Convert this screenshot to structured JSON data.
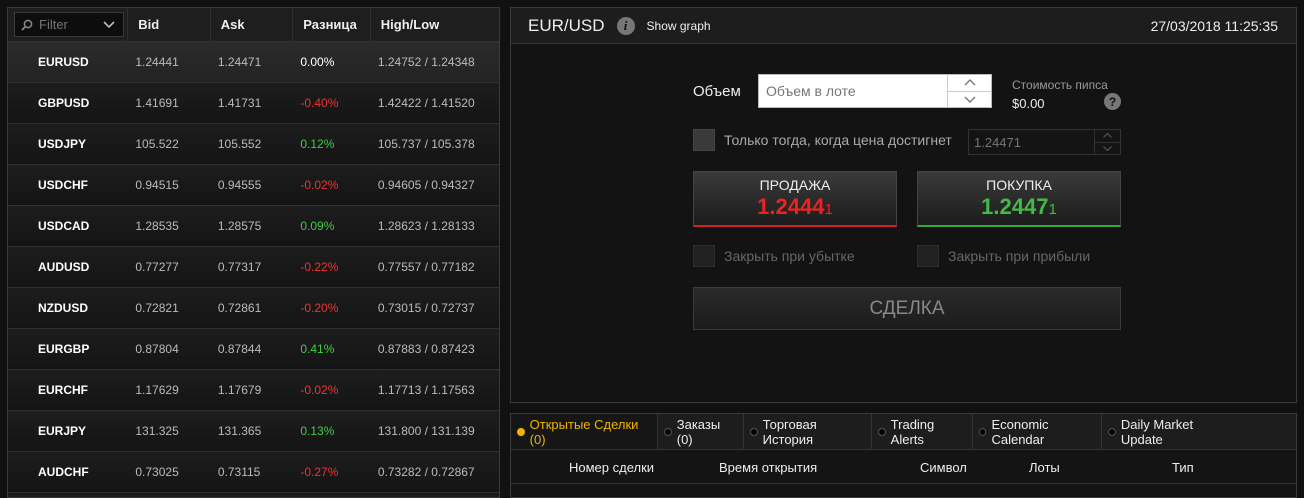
{
  "quotes": {
    "filter_placeholder": "Filter",
    "columns": [
      "Bid",
      "Ask",
      "Разница",
      "High/Low"
    ],
    "rows": [
      {
        "symbol": "EURUSD",
        "bid": "1.24441",
        "ask": "1.24471",
        "change": "0.00%",
        "highlow": "1.24752 / 1.24348",
        "dir": "flat"
      },
      {
        "symbol": "GBPUSD",
        "bid": "1.41691",
        "ask": "1.41731",
        "change": "-0.40%",
        "highlow": "1.42422 / 1.41520",
        "dir": "neg"
      },
      {
        "symbol": "USDJPY",
        "bid": "105.522",
        "ask": "105.552",
        "change": "0.12%",
        "highlow": "105.737 / 105.378",
        "dir": "pos"
      },
      {
        "symbol": "USDCHF",
        "bid": "0.94515",
        "ask": "0.94555",
        "change": "-0.02%",
        "highlow": "0.94605 / 0.94327",
        "dir": "neg"
      },
      {
        "symbol": "USDCAD",
        "bid": "1.28535",
        "ask": "1.28575",
        "change": "0.09%",
        "highlow": "1.28623 / 1.28133",
        "dir": "pos"
      },
      {
        "symbol": "AUDUSD",
        "bid": "0.77277",
        "ask": "0.77317",
        "change": "-0.22%",
        "highlow": "0.77557 / 0.77182",
        "dir": "neg"
      },
      {
        "symbol": "NZDUSD",
        "bid": "0.72821",
        "ask": "0.72861",
        "change": "-0.20%",
        "highlow": "0.73015 / 0.72737",
        "dir": "neg"
      },
      {
        "symbol": "EURGBP",
        "bid": "0.87804",
        "ask": "0.87844",
        "change": "0.41%",
        "highlow": "0.87883 / 0.87423",
        "dir": "pos"
      },
      {
        "symbol": "EURCHF",
        "bid": "1.17629",
        "ask": "1.17679",
        "change": "-0.02%",
        "highlow": "1.17713 / 1.17563",
        "dir": "neg"
      },
      {
        "symbol": "EURJPY",
        "bid": "131.325",
        "ask": "131.365",
        "change": "0.13%",
        "highlow": "131.800 / 131.139",
        "dir": "pos"
      },
      {
        "symbol": "AUDCHF",
        "bid": "0.73025",
        "ask": "0.73115",
        "change": "-0.27%",
        "highlow": "0.73282 / 0.72867",
        "dir": "neg"
      }
    ]
  },
  "trade": {
    "pair": "EUR/USD",
    "info_icon": "i",
    "show_graph": "Show graph",
    "datetime": "27/03/2018 11:25:35",
    "volume_label": "Объем",
    "volume_placeholder": "Объем в лоте",
    "pip_cost_label": "Стоимость пипса",
    "pip_cost_value": "$0.00",
    "help_icon": "?",
    "condition_label": "Только тогда, когда цена достигнет",
    "condition_placeholder": "1.24471",
    "sell": {
      "label": "ПРОДАЖА",
      "price_main": "1.2444",
      "price_pip": "1"
    },
    "buy": {
      "label": "ПОКУПКА",
      "price_main": "1.2447",
      "price_pip": "1"
    },
    "stop_loss_label": "Закрыть при убытке",
    "take_profit_label": "Закрыть при прибыли",
    "deal_label": "СДЕЛКА"
  },
  "bottom": {
    "tabs": [
      "Открытые Сделки (0)",
      "Заказы (0)",
      "Торговая История",
      "Trading Alerts",
      "Economic Calendar",
      "Daily Market Update"
    ],
    "columns": [
      "Номер сделки",
      "Время открытия",
      "Символ",
      "Лоты",
      "Тип"
    ]
  },
  "colors": {
    "accent": "#f0b400",
    "sell": "#e22222",
    "buy": "#44bb44",
    "negative": "#ee3333",
    "positive": "#44cc44"
  }
}
